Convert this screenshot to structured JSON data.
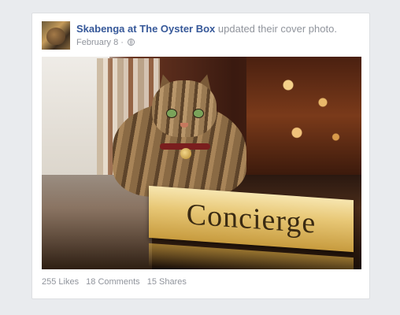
{
  "post": {
    "page_name": "Skabenga at The Oyster Box",
    "action_text": "updated their cover photo.",
    "date": "February 8",
    "separator": "·",
    "privacy_icon": "globe-icon"
  },
  "photo": {
    "sign_text": "Concierge"
  },
  "stats": {
    "likes": "255 Likes",
    "comments": "18 Comments",
    "shares": "15 Shares"
  },
  "colors": {
    "link": "#365899",
    "muted": "#90949c",
    "background": "#e9ebee"
  }
}
